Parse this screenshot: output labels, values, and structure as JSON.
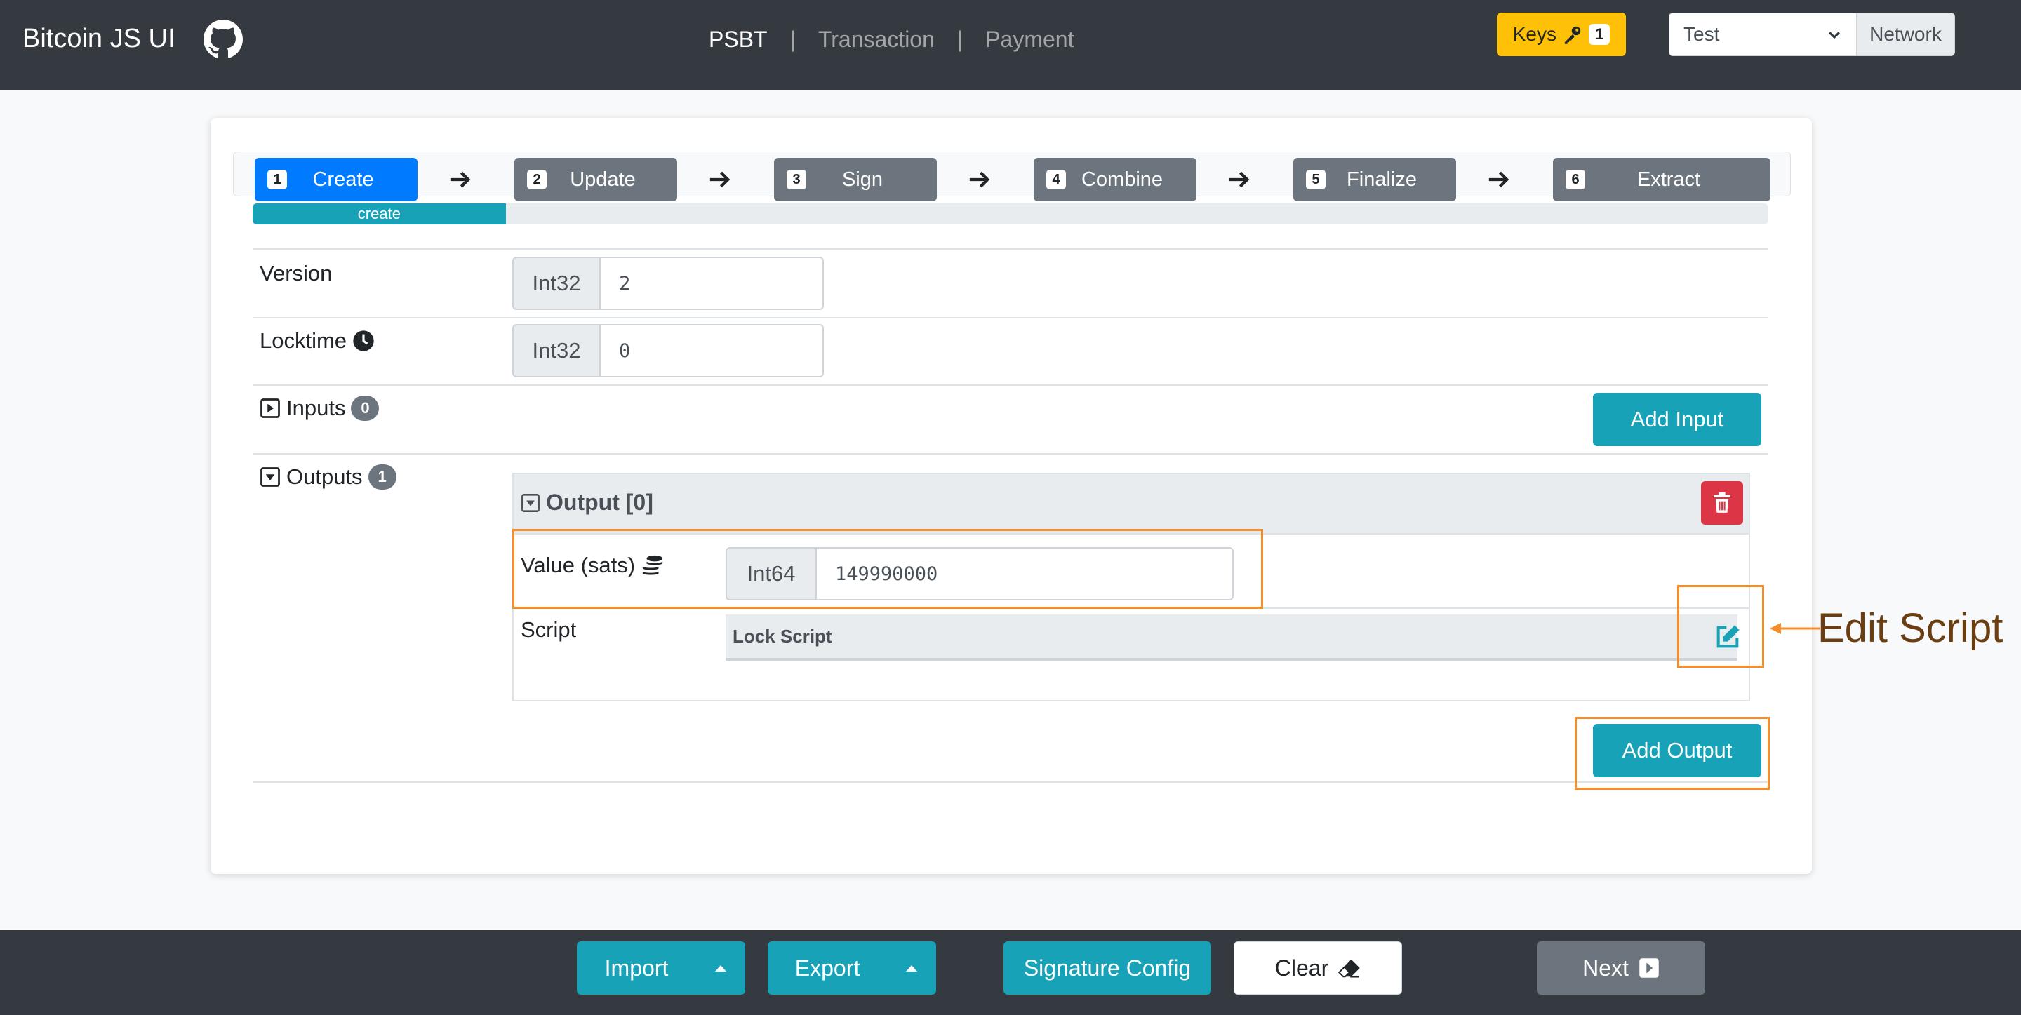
{
  "navbar": {
    "brand": "Bitcoin JS UI",
    "links": [
      {
        "label": "PSBT",
        "active": true
      },
      {
        "label": "Transaction",
        "active": false
      },
      {
        "label": "Payment",
        "active": false
      }
    ],
    "separator": "|",
    "keys_label": "Keys",
    "keys_count": "1",
    "network_value": "Test",
    "network_label": "Network"
  },
  "steps": [
    {
      "num": "1",
      "label": "Create",
      "active": true
    },
    {
      "num": "2",
      "label": "Update",
      "active": false
    },
    {
      "num": "3",
      "label": "Sign",
      "active": false
    },
    {
      "num": "4",
      "label": "Combine",
      "active": false
    },
    {
      "num": "5",
      "label": "Finalize",
      "active": false
    },
    {
      "num": "6",
      "label": "Extract",
      "active": false
    }
  ],
  "progress": {
    "label": "create",
    "fraction": 0.167
  },
  "form": {
    "version": {
      "label": "Version",
      "type": "Int32",
      "value": "2"
    },
    "locktime": {
      "label": "Locktime",
      "type": "Int32",
      "value": "0"
    },
    "inputs": {
      "label": "Inputs",
      "count": "0",
      "add_label": "Add Input"
    },
    "outputs": {
      "label": "Outputs",
      "count": "1",
      "add_label": "Add Output"
    },
    "output0": {
      "title": "Output [0]",
      "value_label": "Value (sats)",
      "value_type": "Int64",
      "value": "149990000",
      "script_label": "Script",
      "lock_script_label": "Lock Script"
    }
  },
  "annotation": {
    "text": "Edit Script",
    "color": "#f28e2b"
  },
  "bottom": {
    "import_label": "Import",
    "export_label": "Export",
    "signature_config_label": "Signature Config",
    "clear_label": "Clear",
    "next_label": "Next"
  },
  "colors": {
    "primary": "#007bff",
    "teal": "#17a2b8",
    "danger": "#dc3545",
    "warning": "#ffc107",
    "dark": "#343a40",
    "secondary": "#6c757d"
  }
}
